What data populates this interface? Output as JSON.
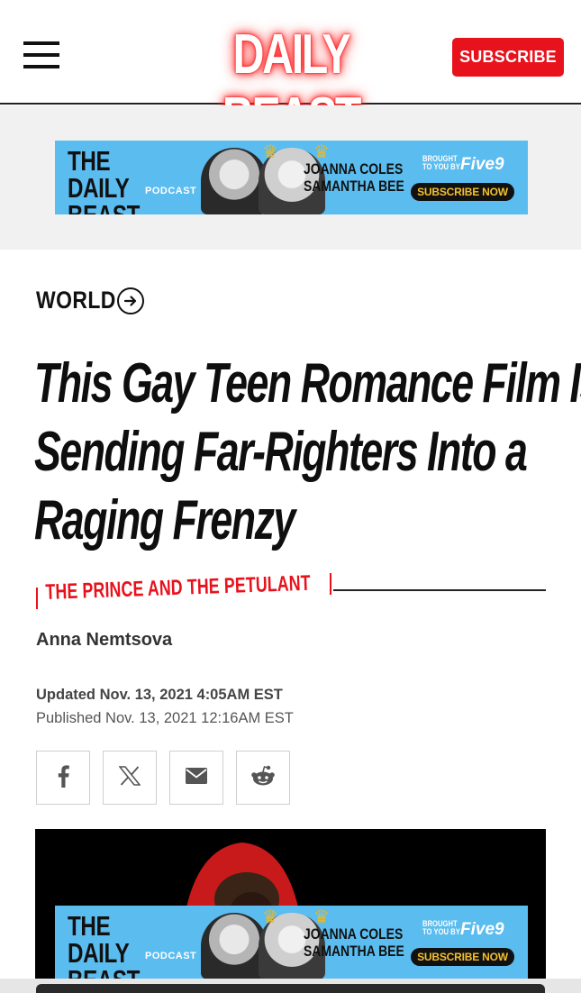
{
  "header": {
    "logo_text": "DAILY BEAST",
    "subscribe_label": "SUBSCRIBE",
    "menu_icon": "hamburger-menu-icon"
  },
  "ad": {
    "title_line1": "THE DAILY",
    "title_line2": "BEAST",
    "podcast_label": "PODCAST",
    "host1": "JOANNA COLES",
    "host2": "SAMANTHA BEE",
    "brought_line1": "BROUGHT",
    "brought_line2": "TO YOU BY",
    "sponsor": "Five9",
    "cta": "SUBSCRIBE NOW"
  },
  "article": {
    "section": "WORLD",
    "headline_lines": [
      "This Gay Teen Romance Film Is",
      "Sending Far-Righters Into a",
      "Raging Frenzy"
    ],
    "kicker": "THE PRINCE AND THE PETULANT",
    "author": "Anna Nemtsova",
    "updated": "Updated Nov. 13, 2021 4:05AM EST",
    "published": "Published Nov. 13, 2021 12:16AM EST"
  },
  "share": [
    {
      "name": "facebook",
      "icon": "facebook-icon"
    },
    {
      "name": "x",
      "icon": "x-icon"
    },
    {
      "name": "email",
      "icon": "email-icon"
    },
    {
      "name": "reddit",
      "icon": "reddit-icon"
    }
  ],
  "colors": {
    "brand_red": "#e8121d",
    "ad_blue": "#5bbcef",
    "ad_gold": "#f4c02a"
  }
}
